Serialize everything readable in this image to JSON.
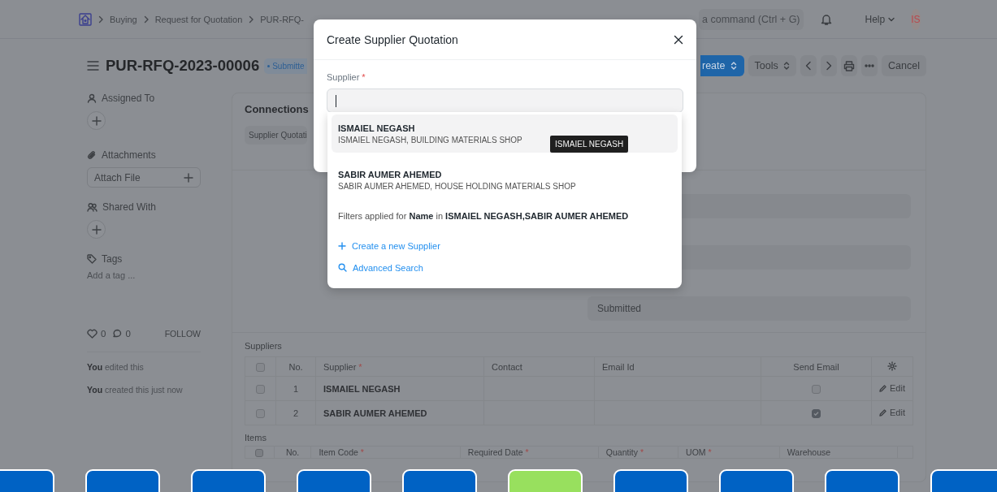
{
  "navbar": {
    "breadcrumbs": [
      "Buying",
      "Request for Quotation",
      "PUR-RFQ-"
    ],
    "search": {
      "placeholder": "a command (Ctrl + G)"
    },
    "help": "Help",
    "avatar": "IS"
  },
  "header": {
    "title": "PUR-RFQ-2023-00006",
    "status": "Submitte",
    "buttons": [
      {
        "kind": "primary",
        "label": "reate"
      },
      {
        "kind": "dropdown",
        "label": "Tools"
      },
      {
        "kind": "prev"
      },
      {
        "kind": "next"
      },
      {
        "kind": "print"
      },
      {
        "kind": "more"
      },
      {
        "kind": "plain",
        "label": "Cancel"
      }
    ]
  },
  "sidebar": {
    "assigned_to": "Assigned To",
    "attachments": "Attachments",
    "attach_file": "Attach File",
    "shared_with": "Shared With",
    "tags": "Tags",
    "add_tag": "Add a tag ...",
    "likes": "0",
    "comments": "0",
    "follow": "FOLLOW",
    "activity": [
      "**You** edited this",
      "**You** created this just now"
    ]
  },
  "connections": {
    "title": "Connections",
    "chips": [
      "Supplier Quotati"
    ]
  },
  "status_field": {
    "value": "Submitted"
  },
  "suppliers": {
    "title": "Suppliers",
    "select_all": false,
    "columns": [
      {
        "label": "No."
      },
      {
        "label": "Supplier",
        "required_mark": "*"
      },
      {
        "label": "Contact"
      },
      {
        "label": "Email Id"
      },
      {
        "label": "Send Email"
      }
    ],
    "rows": [
      {
        "selected": false,
        "no": "1",
        "supplier": "ISMAIEL NEGASH",
        "send_email": false,
        "edit": "Edit"
      },
      {
        "selected": false,
        "no": "2",
        "supplier": "SABIR AUMER AHEMED",
        "send_email": true,
        "edit": "Edit"
      }
    ]
  },
  "items": {
    "title": "Items",
    "select_all": false,
    "columns": [
      {
        "label": "No."
      },
      {
        "label": "Item Code",
        "required_mark": "*"
      },
      {
        "label": "Required Date",
        "required_mark": "*"
      },
      {
        "label": "Quantity",
        "required_mark": "*"
      },
      {
        "label": "UOM",
        "required_mark": "*"
      },
      {
        "label": "Warehouse"
      }
    ]
  },
  "dialog": {
    "title": "Create Supplier Quotation",
    "field": {
      "label": "Supplier",
      "required_mark": "*"
    },
    "options": [
      {
        "title": "ISMAIEL NEGASH",
        "description": "ISMAIEL NEGASH, BUILDING MATERIALS SHOP",
        "selected": true
      },
      {
        "title": "SABIR AUMER AHEMED",
        "description": "SABIR AUMER AHEMED, HOUSE HOLDING MATERIALS SHOP",
        "selected": false
      }
    ],
    "filter_note": "Filters applied for **Name** in **ISMAIEL NEGASH,SABIR AUMER AHEMED**",
    "actions": [
      {
        "kind": "create",
        "label": "Create a new Supplier"
      },
      {
        "kind": "search",
        "label": "Advanced Search"
      }
    ],
    "tooltip": "ISMAIEL NEGASH"
  },
  "tiles": [
    {
      "color": "#0062c4"
    },
    {
      "color": "#0062c4"
    },
    {
      "color": "#0062c4"
    },
    {
      "color": "#0062c4"
    },
    {
      "color": "#0062c4"
    },
    {
      "color": "#98e05e"
    },
    {
      "color": "#0062c4"
    },
    {
      "color": "#0062c4"
    },
    {
      "color": "#0062c4"
    },
    {
      "color": "#0062c4"
    }
  ]
}
